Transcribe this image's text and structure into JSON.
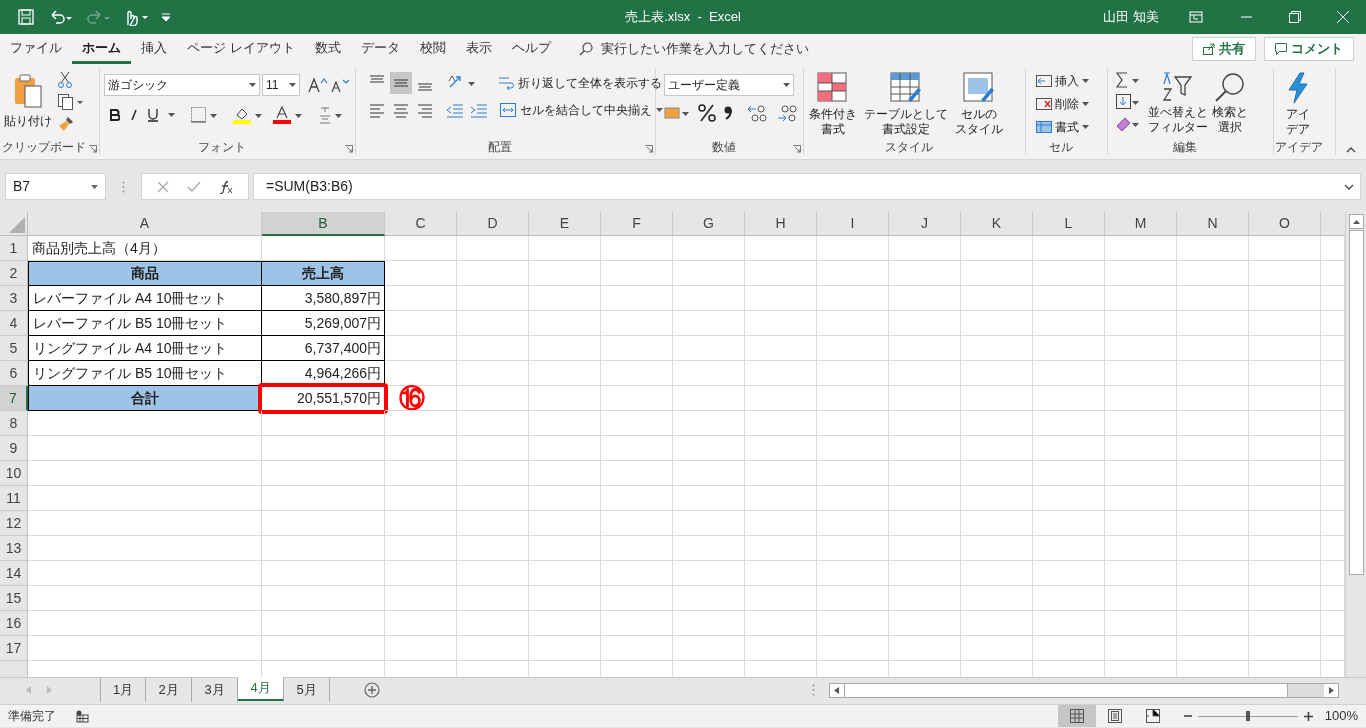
{
  "quick_access": [
    {
      "kind": "save",
      "disabled": false
    },
    {
      "kind": "undo",
      "disabled": false
    },
    {
      "kind": "redo",
      "disabled": true
    },
    {
      "kind": "touch",
      "disabled": false
    }
  ],
  "window": {
    "title": "売上表.xlsx  -  Excel",
    "user": "山田 知美"
  },
  "menu_tabs": [
    {
      "label": "ファイル",
      "selected": false
    },
    {
      "label": "ホーム",
      "selected": true
    },
    {
      "label": "挿入",
      "selected": false
    },
    {
      "label": "ページ レイアウト",
      "selected": false
    },
    {
      "label": "数式",
      "selected": false
    },
    {
      "label": "データ",
      "selected": false
    },
    {
      "label": "校閲",
      "selected": false
    },
    {
      "label": "表示",
      "selected": false
    },
    {
      "label": "ヘルプ",
      "selected": false
    }
  ],
  "search": {
    "placeholder": "実行したい作業を入力してください"
  },
  "share_button": "共有",
  "comment_button": "コメント",
  "ribbon": [
    {
      "kind": "clipboard",
      "label": "クリップボード",
      "paste": "貼り付け"
    },
    {
      "kind": "font",
      "label": "フォント",
      "font_name": "游ゴシック",
      "font_size": "11"
    },
    {
      "kind": "alignment",
      "label": "配置",
      "wrap": "折り返して全体を表示する",
      "merge": "セルを結合して中央揃え",
      "vertical_align": [
        {
          "selected": false
        },
        {
          "selected": true
        },
        {
          "selected": false
        }
      ]
    },
    {
      "kind": "number",
      "label": "数値",
      "format": "ユーザー定義"
    },
    {
      "kind": "styles",
      "label": "スタイル",
      "buttons": [
        {
          "lines": [
            "条件付き",
            "書式"
          ]
        },
        {
          "lines": [
            "テーブルとして",
            "書式設定"
          ]
        },
        {
          "lines": [
            "セルの",
            "スタイル"
          ]
        }
      ]
    },
    {
      "kind": "cells",
      "label": "セル",
      "buttons": [
        "挿入",
        "削除",
        "書式"
      ]
    },
    {
      "kind": "editing",
      "label": "編集",
      "buttons": [
        {
          "lines": [
            "並べ替えと",
            "フィルター"
          ]
        },
        {
          "lines": [
            "検索と",
            "選択"
          ]
        }
      ]
    },
    {
      "kind": "ideas",
      "label": "アイデア",
      "buttons": [
        {
          "lines": [
            "アイ",
            "デア"
          ]
        }
      ]
    }
  ],
  "name_box": "B7",
  "formula": "=SUM(B3:B6)",
  "columns": [
    {
      "label": "A",
      "selected": false
    },
    {
      "label": "B",
      "selected": true
    },
    {
      "label": "C",
      "selected": false
    },
    {
      "label": "D",
      "selected": false
    },
    {
      "label": "E",
      "selected": false
    },
    {
      "label": "F",
      "selected": false
    },
    {
      "label": "G",
      "selected": false
    },
    {
      "label": "H",
      "selected": false
    },
    {
      "label": "I",
      "selected": false
    },
    {
      "label": "J",
      "selected": false
    },
    {
      "label": "K",
      "selected": false
    },
    {
      "label": "L",
      "selected": false
    },
    {
      "label": "M",
      "selected": false
    },
    {
      "label": "N",
      "selected": false
    },
    {
      "label": "O",
      "selected": false
    }
  ],
  "rows": [
    {
      "number": "1",
      "selected": false,
      "cells": [
        {
          "kind": "title",
          "text": "商品別売上高（4月）"
        }
      ]
    },
    {
      "number": "2",
      "selected": false,
      "cells": [
        {
          "kind": "header",
          "text": "商品"
        },
        {
          "kind": "header",
          "text": "売上高"
        }
      ]
    },
    {
      "number": "3",
      "selected": false,
      "cells": [
        {
          "kind": "item",
          "text": "レバーファイル A4 10冊セット"
        },
        {
          "kind": "amount",
          "text": "3,580,897円"
        }
      ]
    },
    {
      "number": "4",
      "selected": false,
      "cells": [
        {
          "kind": "item",
          "text": "レバーファイル B5 10冊セット"
        },
        {
          "kind": "amount",
          "text": "5,269,007円"
        }
      ]
    },
    {
      "number": "5",
      "selected": false,
      "cells": [
        {
          "kind": "item",
          "text": "リングファイル A4 10冊セット"
        },
        {
          "kind": "amount",
          "text": "6,737,400円"
        }
      ]
    },
    {
      "number": "6",
      "selected": false,
      "cells": [
        {
          "kind": "item",
          "text": "リングファイル B5 10冊セット"
        },
        {
          "kind": "amount",
          "text": "4,964,266円"
        }
      ]
    },
    {
      "number": "7",
      "selected": true,
      "cells": [
        {
          "kind": "header",
          "text": "合計"
        },
        {
          "kind": "amount",
          "text": "20,551,570円",
          "highlighted": true
        }
      ],
      "marker": "⑯"
    },
    {
      "number": "8",
      "selected": false
    },
    {
      "number": "9",
      "selected": false
    },
    {
      "number": "10",
      "selected": false
    },
    {
      "number": "11",
      "selected": false
    },
    {
      "number": "12",
      "selected": false
    },
    {
      "number": "13",
      "selected": false
    },
    {
      "number": "14",
      "selected": false
    },
    {
      "number": "15",
      "selected": false
    },
    {
      "number": "16",
      "selected": false
    },
    {
      "number": "17",
      "selected": false
    }
  ],
  "sheets": [
    {
      "label": "1月",
      "selected": false
    },
    {
      "label": "2月",
      "selected": false
    },
    {
      "label": "3月",
      "selected": false
    },
    {
      "label": "4月",
      "selected": true
    },
    {
      "label": "5月",
      "selected": false
    }
  ],
  "status": "準備完了",
  "views": [
    {
      "kind": "normal",
      "selected": true
    },
    {
      "kind": "page_layout",
      "selected": false
    },
    {
      "kind": "page_break",
      "selected": false
    }
  ],
  "zoom": {
    "level": 0.5,
    "label": "100%"
  }
}
